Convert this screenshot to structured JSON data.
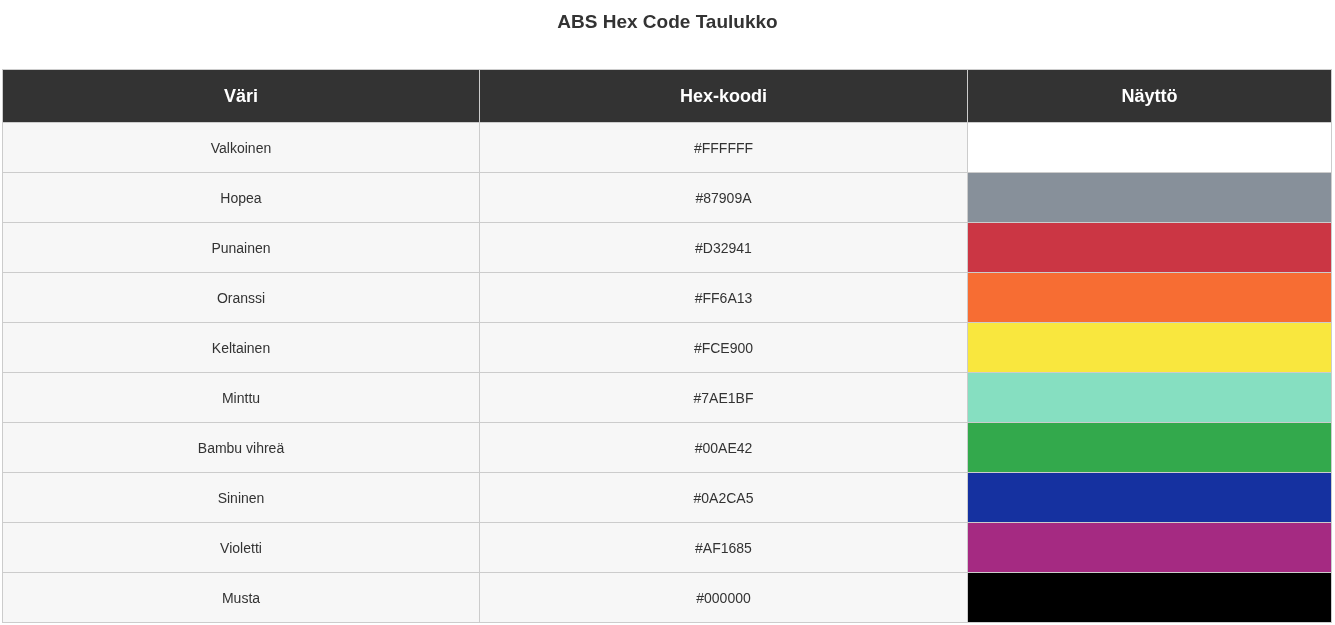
{
  "title": "ABS Hex Code Taulukko",
  "table": {
    "columns": [
      "Väri",
      "Hex-koodi",
      "Näyttö"
    ],
    "rows": [
      {
        "name": "Valkoinen",
        "hex": "#FFFFFF",
        "color": "#ffffff"
      },
      {
        "name": "Hopea",
        "hex": "#87909A",
        "color": "#87909a"
      },
      {
        "name": "Punainen",
        "hex": "#D32941",
        "color": "#cb3644"
      },
      {
        "name": "Oranssi",
        "hex": "#FF6A13",
        "color": "#f76d33"
      },
      {
        "name": "Keltainen",
        "hex": "#FCE900",
        "color": "#f9e73e"
      },
      {
        "name": "Minttu",
        "hex": "#7AE1BF",
        "color": "#86dfc1"
      },
      {
        "name": "Bambu vihreä",
        "hex": "#00AE42",
        "color": "#33a94c"
      },
      {
        "name": "Sininen",
        "hex": "#0A2CA5",
        "color": "#1531a0"
      },
      {
        "name": "Violetti",
        "hex": "#AF1685",
        "color": "#a52a82"
      },
      {
        "name": "Musta",
        "hex": "#000000",
        "color": "#000000"
      }
    ]
  }
}
